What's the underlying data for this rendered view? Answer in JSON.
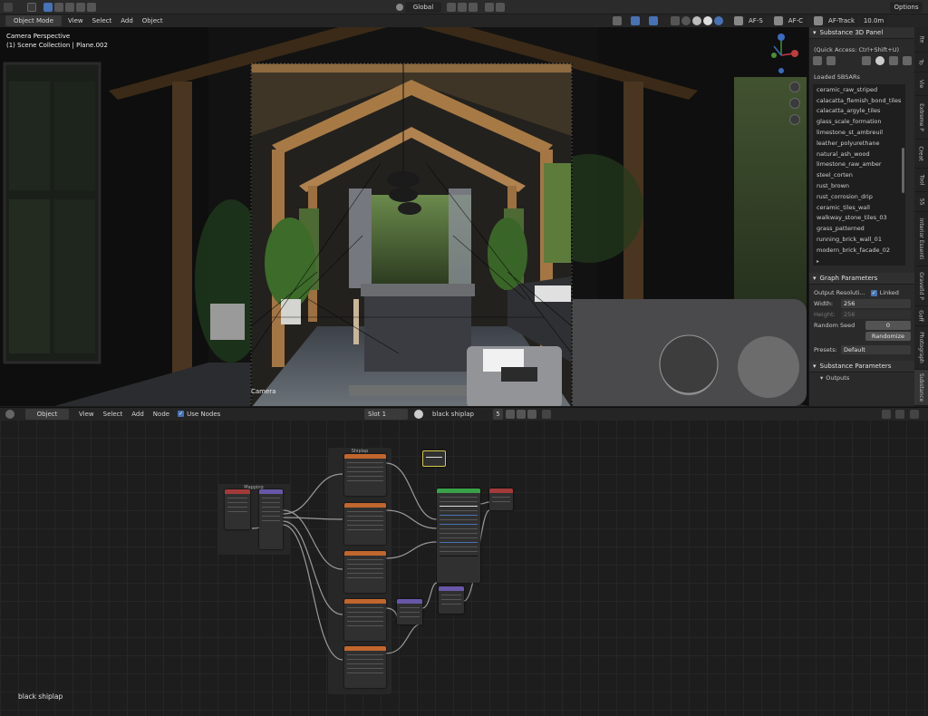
{
  "topbar": {
    "transform_orientation": "Global",
    "options_label": "Options"
  },
  "viewport_header": {
    "mode": "Object Mode",
    "menus": [
      "View",
      "Select",
      "Add",
      "Object"
    ],
    "af_s": "AF-S",
    "af_c": "AF-C",
    "af_track": "AF-Track",
    "distance": "10.0m"
  },
  "viewport": {
    "view_name": "Camera Perspective",
    "collection": "(1) Scene Collection | Plane.002",
    "camera_label": "Camera"
  },
  "side_panel": {
    "title": "Substance 3D Panel",
    "quick_access": "(Quick Access: Ctrl+Shift+U)",
    "loaded_label": "Loaded SBSARs",
    "sbsars": [
      "ceramic_raw_striped",
      "calacatta_flemish_bond_tiles",
      "calacatta_argyle_tiles",
      "glass_scale_formation",
      "limestone_st_ambreuil",
      "leather_polyurethane",
      "natural_ash_wood",
      "limestone_raw_amber",
      "steel_corten",
      "rust_brown",
      "rust_corrosion_drip",
      "ceramic_tiles_wall",
      "walkway_stone_tiles_03",
      "grass_patterned",
      "running_brick_wall_01",
      "modern_brick_facade_02"
    ],
    "graph_params_title": "Graph Parameters",
    "output_resolution_label": "Output Resoluti...",
    "linked_label": "Linked",
    "width_label": "Width:",
    "width_value": "256",
    "height_label": "Height:",
    "height_value": "256",
    "random_seed_label": "Random Seed",
    "random_seed_value": "0",
    "randomize_label": "Randomize",
    "presets_label": "Presets:",
    "presets_value": "Default",
    "substance_params_title": "Substance Parameters",
    "outputs_label": "Outputs"
  },
  "side_tabs": [
    "Ite",
    "To",
    "Vie",
    "Extreme P",
    "Creat",
    "Tool",
    "SS",
    "Interior Essenti",
    "Gravelld P",
    "Gaff",
    "Photograph",
    "Substance"
  ],
  "node_header": {
    "mode": "Object",
    "menus": [
      "View",
      "Select",
      "Add",
      "Node"
    ],
    "use_nodes_label": "Use Nodes",
    "slot": "Slot 1",
    "material": "black shiplap",
    "users": "5"
  },
  "node_editor": {
    "material_label": "black shiplap",
    "frame_mapping": "Mapping",
    "frame_shiplap": "Shiplap"
  },
  "colors": {
    "accent": "#4772b3",
    "header_bg": "#2b2b2b",
    "panel_bg": "#2a2a2a",
    "node_texture": "#c0662e",
    "node_shader": "#3aa04a",
    "node_output": "#a33a3a",
    "node_vector": "#6857a8"
  }
}
